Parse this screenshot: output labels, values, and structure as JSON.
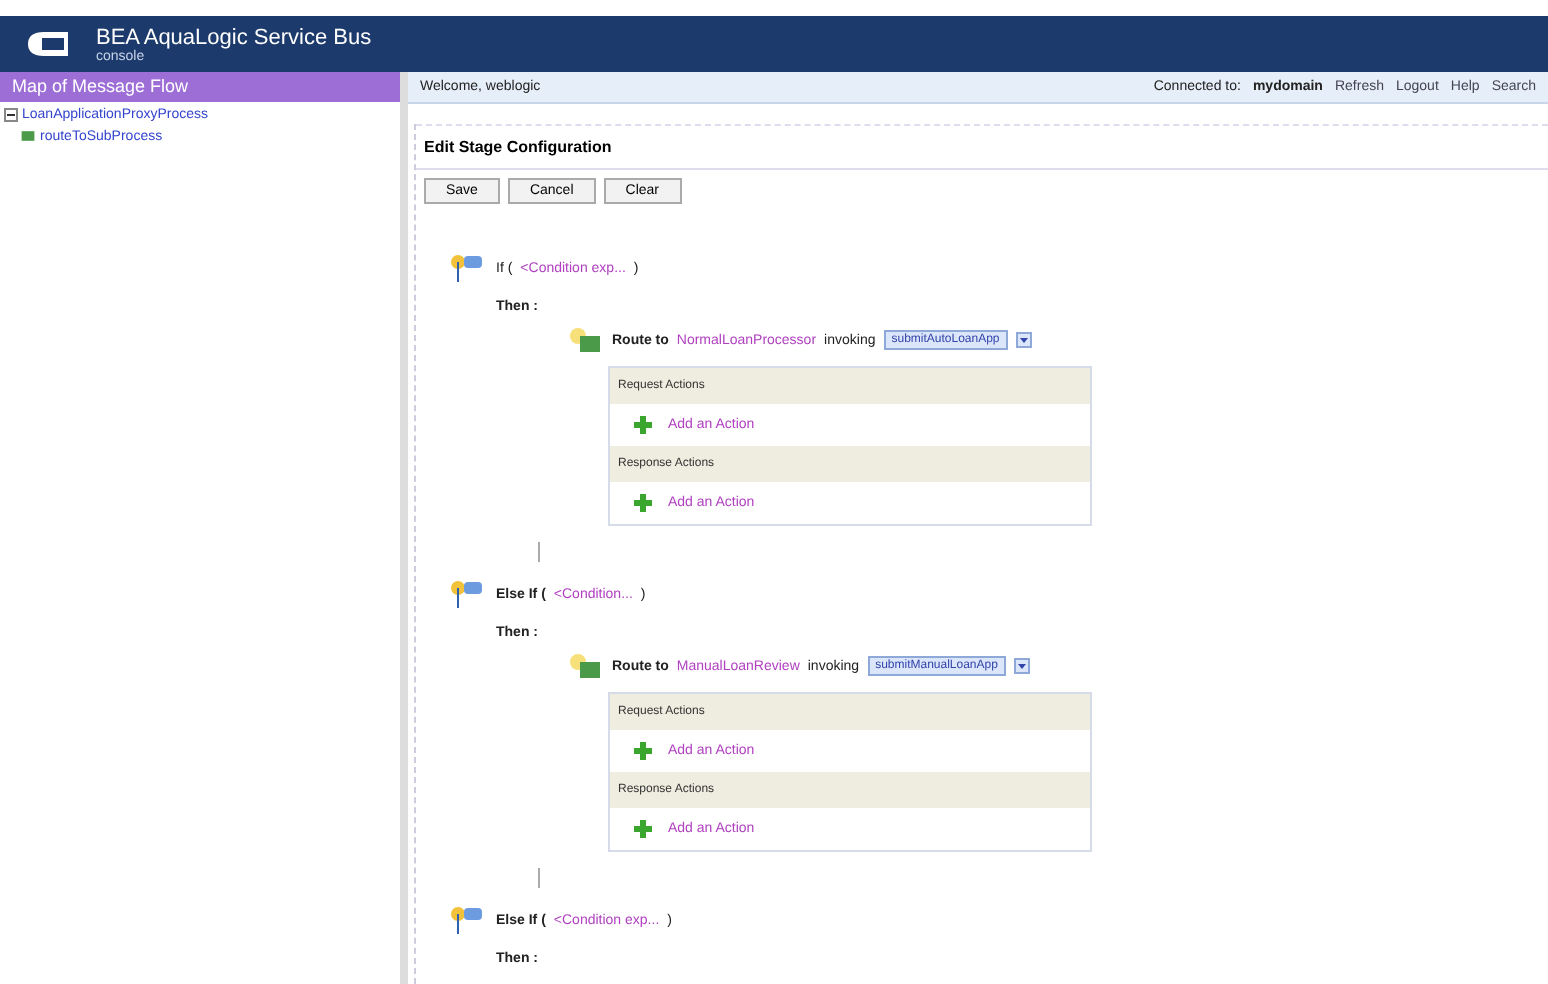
{
  "header": {
    "title": "BEA AquaLogic Service Bus",
    "subtitle": "console"
  },
  "sidebar": {
    "title": "Map of Message Flow",
    "tree": [
      {
        "label": "LoanApplicationProxyProcess",
        "expanded": true,
        "children": [
          {
            "label": "routeToSubProcess"
          }
        ]
      }
    ]
  },
  "topbar": {
    "welcome": "Welcome, weblogic",
    "connected_label": "Connected to:",
    "connected_value": "mydomain",
    "links": [
      "Refresh",
      "Logout",
      "Help",
      "Search"
    ]
  },
  "editor": {
    "title": "Edit Stage Configuration",
    "buttons": [
      "Save",
      "Cancel",
      "Clear"
    ],
    "branches": [
      {
        "keyword": "If (",
        "condition": "<Condition exp...",
        "close": ")",
        "then": "Then :",
        "route": {
          "prefix": "Route to",
          "service": "NormalLoanProcessor",
          "suffix": "invoking",
          "operation": "submitAutoLoanApp",
          "sections": [
            {
              "title": "Request Actions",
              "action": "Add an Action"
            },
            {
              "title": "Response Actions",
              "action": "Add an Action"
            }
          ]
        }
      },
      {
        "keyword": "Else If (",
        "condition": "<Condition...",
        "close": ")",
        "then": "Then :",
        "route": {
          "prefix": "Route to",
          "service": "ManualLoanReview",
          "suffix": "invoking",
          "operation": "submitManualLoanApp",
          "sections": [
            {
              "title": "Request Actions",
              "action": "Add an Action"
            },
            {
              "title": "Response Actions",
              "action": "Add an Action"
            }
          ]
        }
      },
      {
        "keyword": "Else If (",
        "condition": "<Condition exp...",
        "close": ")",
        "then": "Then :"
      }
    ]
  }
}
